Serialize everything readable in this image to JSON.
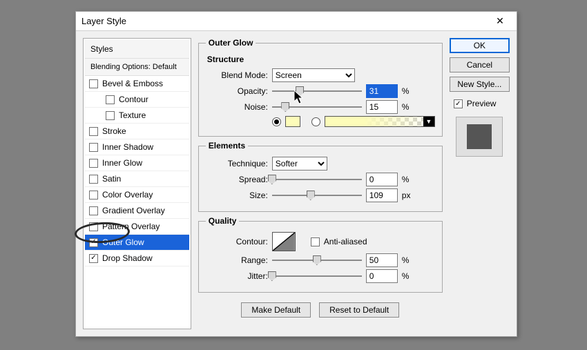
{
  "window": {
    "title": "Layer Style"
  },
  "styles_panel": {
    "header": "Styles",
    "subheader": "Blending Options: Default",
    "items": [
      {
        "label": "Bevel & Emboss",
        "checked": false,
        "indent": false
      },
      {
        "label": "Contour",
        "checked": false,
        "indent": true
      },
      {
        "label": "Texture",
        "checked": false,
        "indent": true
      },
      {
        "label": "Stroke",
        "checked": false,
        "indent": false
      },
      {
        "label": "Inner Shadow",
        "checked": false,
        "indent": false
      },
      {
        "label": "Inner Glow",
        "checked": false,
        "indent": false
      },
      {
        "label": "Satin",
        "checked": false,
        "indent": false
      },
      {
        "label": "Color Overlay",
        "checked": false,
        "indent": false
      },
      {
        "label": "Gradient Overlay",
        "checked": false,
        "indent": false
      },
      {
        "label": "Pattern Overlay",
        "checked": false,
        "indent": false
      },
      {
        "label": "Outer Glow",
        "checked": true,
        "indent": false,
        "selected": true
      },
      {
        "label": "Drop Shadow",
        "checked": true,
        "indent": false
      }
    ]
  },
  "group_title": "Outer Glow",
  "structure": {
    "legend": "Structure",
    "blend_mode_label": "Blend Mode:",
    "blend_mode_value": "Screen",
    "opacity_label": "Opacity:",
    "opacity_value": "31",
    "opacity_unit": "%",
    "noise_label": "Noise:",
    "noise_value": "15",
    "noise_unit": "%",
    "color_hex": "#fdfcb9"
  },
  "elements": {
    "legend": "Elements",
    "technique_label": "Technique:",
    "technique_value": "Softer",
    "spread_label": "Spread:",
    "spread_value": "0",
    "spread_unit": "%",
    "size_label": "Size:",
    "size_value": "109",
    "size_unit": "px"
  },
  "quality": {
    "legend": "Quality",
    "contour_label": "Contour:",
    "anti_aliased_label": "Anti-aliased",
    "anti_aliased_checked": false,
    "range_label": "Range:",
    "range_value": "50",
    "range_unit": "%",
    "jitter_label": "Jitter:",
    "jitter_value": "0",
    "jitter_unit": "%"
  },
  "footer": {
    "make_default": "Make Default",
    "reset_default": "Reset to Default"
  },
  "right": {
    "ok": "OK",
    "cancel": "Cancel",
    "new_style": "New Style...",
    "preview_label": "Preview",
    "preview_checked": true
  }
}
